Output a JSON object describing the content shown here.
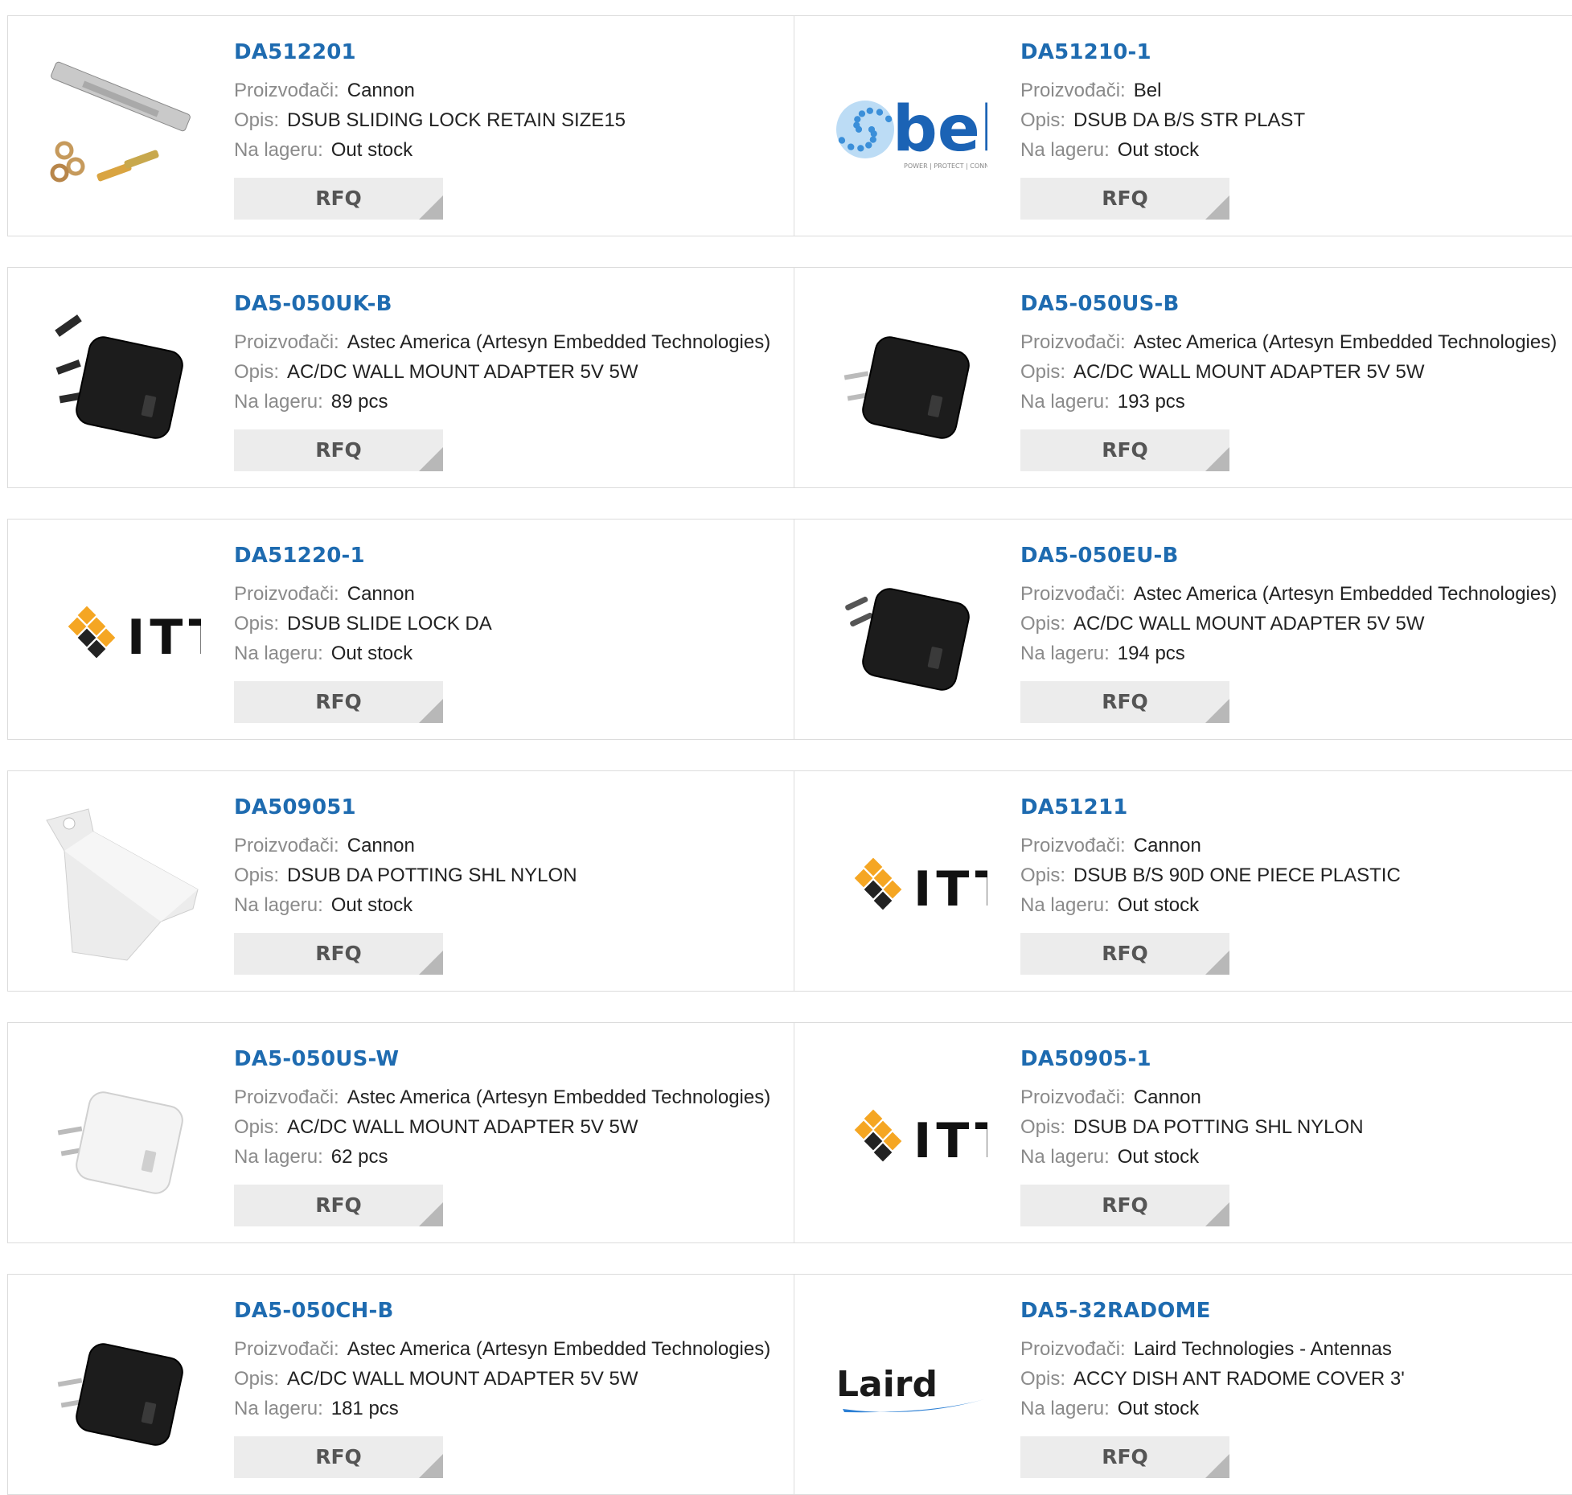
{
  "labels": {
    "manufacturer": "Proizvođači:",
    "description": "Opis:",
    "stock": "Na lageru:",
    "rfq": "RFQ"
  },
  "colors": {
    "part_link": "#1e6bb0",
    "label": "#8a8a8a",
    "button_bg": "#ececec"
  },
  "products": [
    {
      "pn": "DA512201",
      "manufacturer": "Cannon",
      "description": "DSUB SLIDING LOCK RETAIN SIZE15",
      "stock": "Out stock",
      "image": "sliding-lock-hardware-photo"
    },
    {
      "pn": "DA51210-1",
      "manufacturer": "Bel",
      "description": "DSUB DA B/S STR PLAST",
      "stock": "Out stock",
      "image": "bel-logo",
      "logo_text": "bel",
      "logo_tagline": "POWER | PROTECT | CONNECT"
    },
    {
      "pn": "DA5-050UK-B",
      "manufacturer": "Astec America (Artesyn Embedded Technologies)",
      "description": "AC/DC WALL MOUNT ADAPTER 5V 5W",
      "stock": "89 pcs",
      "image": "uk-adapter-black-photo"
    },
    {
      "pn": "DA5-050US-B",
      "manufacturer": "Astec America (Artesyn Embedded Technologies)",
      "description": "AC/DC WALL MOUNT ADAPTER 5V 5W",
      "stock": "193 pcs",
      "image": "us-adapter-black-photo"
    },
    {
      "pn": "DA51220-1",
      "manufacturer": "Cannon",
      "description": "DSUB SLIDE LOCK DA",
      "stock": "Out stock",
      "image": "itt-logo",
      "logo_text": "ITT"
    },
    {
      "pn": "DA5-050EU-B",
      "manufacturer": "Astec America (Artesyn Embedded Technologies)",
      "description": "AC/DC WALL MOUNT ADAPTER 5V 5W",
      "stock": "194 pcs",
      "image": "eu-adapter-black-photo"
    },
    {
      "pn": "DA509051",
      "manufacturer": "Cannon",
      "description": "DSUB DA POTTING SHL NYLON",
      "stock": "Out stock",
      "image": "potting-shell-photo"
    },
    {
      "pn": "DA51211",
      "manufacturer": "Cannon",
      "description": "DSUB B/S 90D ONE PIECE PLASTIC",
      "stock": "Out stock",
      "image": "itt-logo",
      "logo_text": "ITT"
    },
    {
      "pn": "DA5-050US-W",
      "manufacturer": "Astec America (Artesyn Embedded Technologies)",
      "description": "AC/DC WALL MOUNT ADAPTER 5V 5W",
      "stock": "62 pcs",
      "image": "us-adapter-white-photo"
    },
    {
      "pn": "DA50905-1",
      "manufacturer": "Cannon",
      "description": "DSUB DA POTTING SHL NYLON",
      "stock": "Out stock",
      "image": "itt-logo",
      "logo_text": "ITT"
    },
    {
      "pn": "DA5-050CH-B",
      "manufacturer": "Astec America (Artesyn Embedded Technologies)",
      "description": "AC/DC WALL MOUNT ADAPTER 5V 5W",
      "stock": "181 pcs",
      "image": "ch-adapter-black-photo"
    },
    {
      "pn": "DA5-32RADOME",
      "manufacturer": "Laird Technologies - Antennas",
      "description": "ACCY DISH ANT RADOME COVER 3'",
      "stock": "Out stock",
      "image": "laird-logo",
      "logo_text": "Laird"
    }
  ]
}
